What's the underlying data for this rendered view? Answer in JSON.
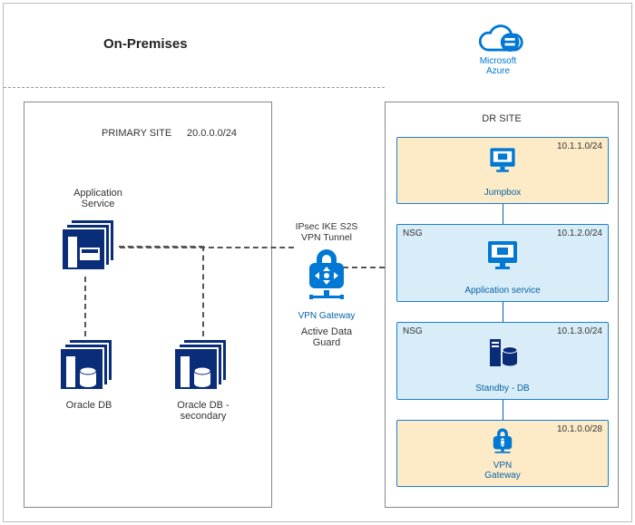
{
  "headers": {
    "on_premises": "On-Premises",
    "azure": "Microsoft\nAzure"
  },
  "primary_site": {
    "title": "PRIMARY SITE",
    "cidr": "20.0.0.0/24",
    "app_service": {
      "label": "Application\nService"
    },
    "oracle_db": {
      "label": "Oracle DB"
    },
    "oracle_db_secondary": {
      "label": "Oracle DB -\nsecondary"
    }
  },
  "center": {
    "tunnel_label": "IPsec IKE S2S\nVPN Tunnel",
    "vpn_gateway_label": "VPN Gateway",
    "data_guard_label": "Active Data Guard"
  },
  "dr_site": {
    "title": "DR SITE",
    "jumpbox": {
      "cidr": "10.1.1.0/24",
      "label": "Jumpbox"
    },
    "appsvc": {
      "cidr": "10.1.2.0/24",
      "nsg": "NSG",
      "label": "Application service"
    },
    "standby": {
      "cidr": "10.1.3.0/24",
      "nsg": "NSG",
      "label": "Standby - DB"
    },
    "vpngw": {
      "cidr": "10.1.0.0/28",
      "label": "VPN\nGateway"
    }
  }
}
